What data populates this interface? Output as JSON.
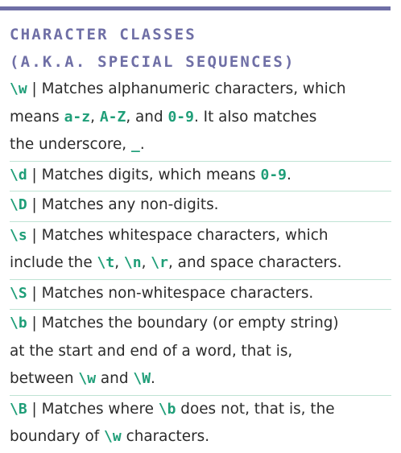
{
  "heading": {
    "line1": "CHARACTER CLASSES",
    "line2": "(A.K.A. SPECIAL SEQUENCES)"
  },
  "entries": [
    {
      "code": "\\w",
      "t1": " | Matches alphanumeric characters, which",
      "t2": "means ",
      "c1": "a-z",
      "t3": ", ",
      "c2": "A-Z",
      "t4": ", and ",
      "c3": "0-9",
      "t5": ". It also matches",
      "t6": "the underscore, ",
      "c4": "_",
      "t7": "."
    },
    {
      "code": "\\d",
      "t1": " | Matches digits, which means ",
      "c1": "0-9",
      "t2": "."
    },
    {
      "code": "\\D",
      "t1": " | Matches any non-digits."
    },
    {
      "code": "\\s",
      "t1": " | Matches whitespace characters, which",
      "t2": "include the ",
      "c1": "\\t",
      "t3": ", ",
      "c2": "\\n",
      "t4": ", ",
      "c3": "\\r",
      "t5": ", and space characters."
    },
    {
      "code": "\\S",
      "t1": " | Matches non-whitespace characters."
    },
    {
      "code": "\\b",
      "t1": " | Matches the boundary (or empty string)",
      "t2": "at the start and end of a word, that is,",
      "t3": "between ",
      "c1": "\\w",
      "t4": " and ",
      "c2": "\\W",
      "t5": "."
    },
    {
      "code": "\\B",
      "t1": " | Matches where ",
      "c1": "\\b",
      "t2": " does not, that is, the",
      "t3": "boundary of ",
      "c2": "\\w",
      "t4": " characters."
    }
  ],
  "colors": {
    "accent_purple": "#6f6fa6",
    "code_green": "#1f9e78",
    "rule_green": "#bfe3d4",
    "text": "#2b2b2b"
  }
}
